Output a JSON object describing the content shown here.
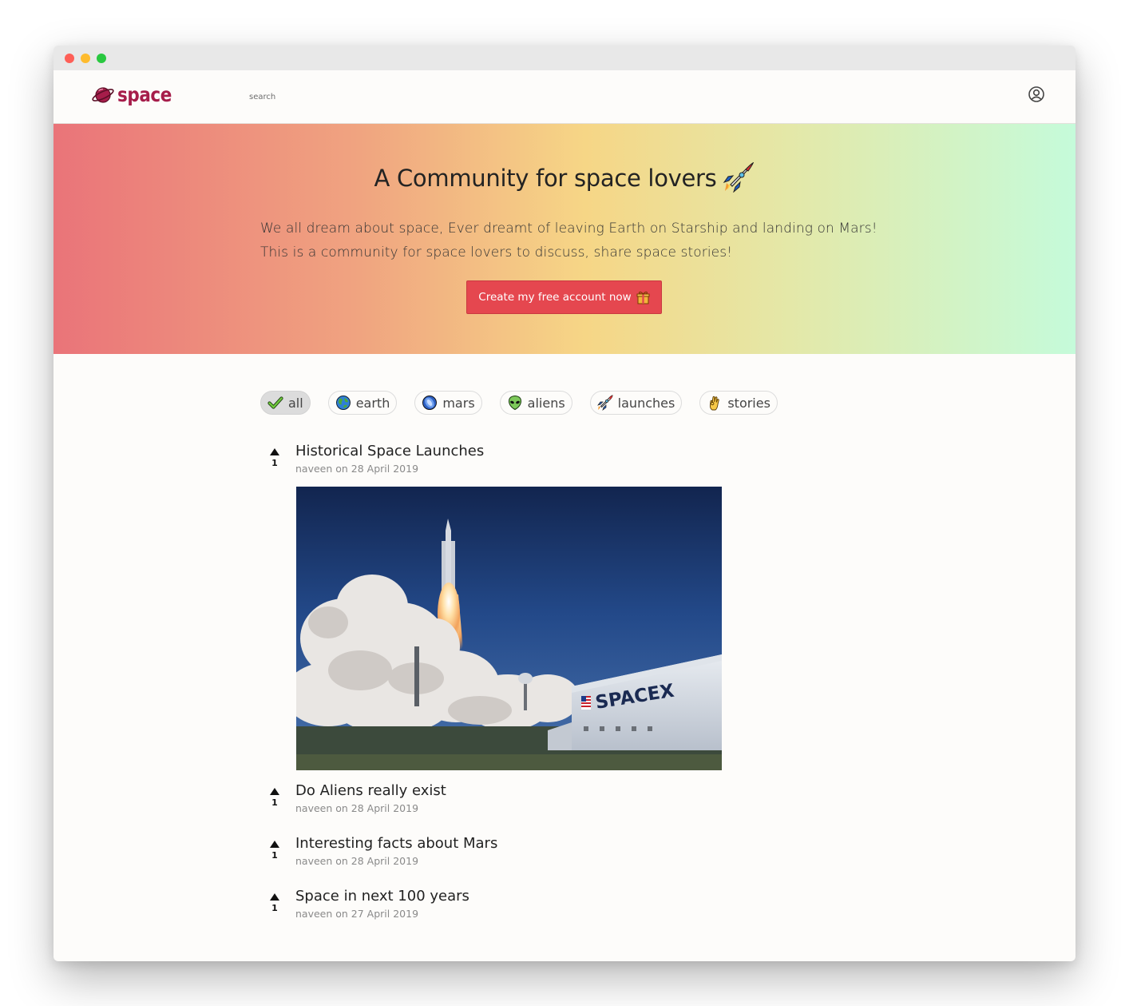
{
  "app": {
    "logo_text": "space",
    "search_placeholder": "search"
  },
  "hero": {
    "title": "A Community for space lovers",
    "description_line1": "We all dream about space, Ever dreamt of leaving Earth on Starship and landing on Mars!",
    "description_line2": "This is a community for space lovers to discuss, share space stories!",
    "cta_label": "Create my free account now"
  },
  "categories": [
    {
      "label": "all",
      "icon": "check-icon",
      "active": true
    },
    {
      "label": "earth",
      "icon": "earth-globe-icon",
      "active": false
    },
    {
      "label": "mars",
      "icon": "planet-icon",
      "active": false
    },
    {
      "label": "aliens",
      "icon": "alien-icon",
      "active": false
    },
    {
      "label": "launches",
      "icon": "rocket-icon",
      "active": false
    },
    {
      "label": "stories",
      "icon": "ok-hand-icon",
      "active": false
    }
  ],
  "posts": [
    {
      "votes": "1",
      "title": "Historical Space Launches",
      "author": "naveen",
      "date": "28 April 2019",
      "meta": "naveen on 28 April 2019",
      "image_sign": "SPACEX"
    },
    {
      "votes": "1",
      "title": "Do Aliens really exist",
      "author": "naveen",
      "date": "28 April 2019",
      "meta": "naveen on 28 April 2019"
    },
    {
      "votes": "1",
      "title": "Interesting facts about Mars",
      "author": "naveen",
      "date": "28 April 2019",
      "meta": "naveen on 28 April 2019"
    },
    {
      "votes": "1",
      "title": "Space in next 100 years",
      "author": "naveen",
      "date": "27 April 2019",
      "meta": "naveen on 27 April 2019"
    }
  ],
  "colors": {
    "brand": "#a61d4a",
    "cta": "#e5474f",
    "hero_gradient": [
      "#ea7479",
      "#f6d686",
      "#c5fbda"
    ]
  }
}
